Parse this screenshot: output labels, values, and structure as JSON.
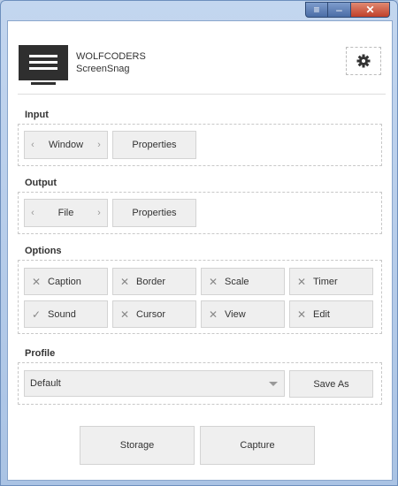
{
  "window": {
    "caption_buttons": {
      "menu_icon": "menu-icon",
      "minimize_icon": "minimize-icon",
      "close_icon": "close-icon"
    }
  },
  "header": {
    "brand_name": "WOLFCODERS",
    "product_name": "ScreenSnag",
    "logo_icon": "monitor-icon",
    "settings_icon": "gear-icon"
  },
  "input": {
    "label": "Input",
    "source": "Window",
    "properties_label": "Properties"
  },
  "output": {
    "label": "Output",
    "target": "File",
    "properties_label": "Properties"
  },
  "options": {
    "label": "Options",
    "items": [
      {
        "label": "Caption",
        "checked": false
      },
      {
        "label": "Border",
        "checked": false
      },
      {
        "label": "Scale",
        "checked": false
      },
      {
        "label": "Timer",
        "checked": false
      },
      {
        "label": "Sound",
        "checked": true
      },
      {
        "label": "Cursor",
        "checked": false
      },
      {
        "label": "View",
        "checked": false
      },
      {
        "label": "Edit",
        "checked": false
      }
    ]
  },
  "profile": {
    "label": "Profile",
    "selected": "Default",
    "save_as_label": "Save As"
  },
  "footer": {
    "storage_label": "Storage",
    "capture_label": "Capture"
  },
  "colors": {
    "button_bg": "#efefef",
    "button_border": "#d3d3d3",
    "title_bar": "#aac3e4",
    "close_button": "#c0402a"
  }
}
